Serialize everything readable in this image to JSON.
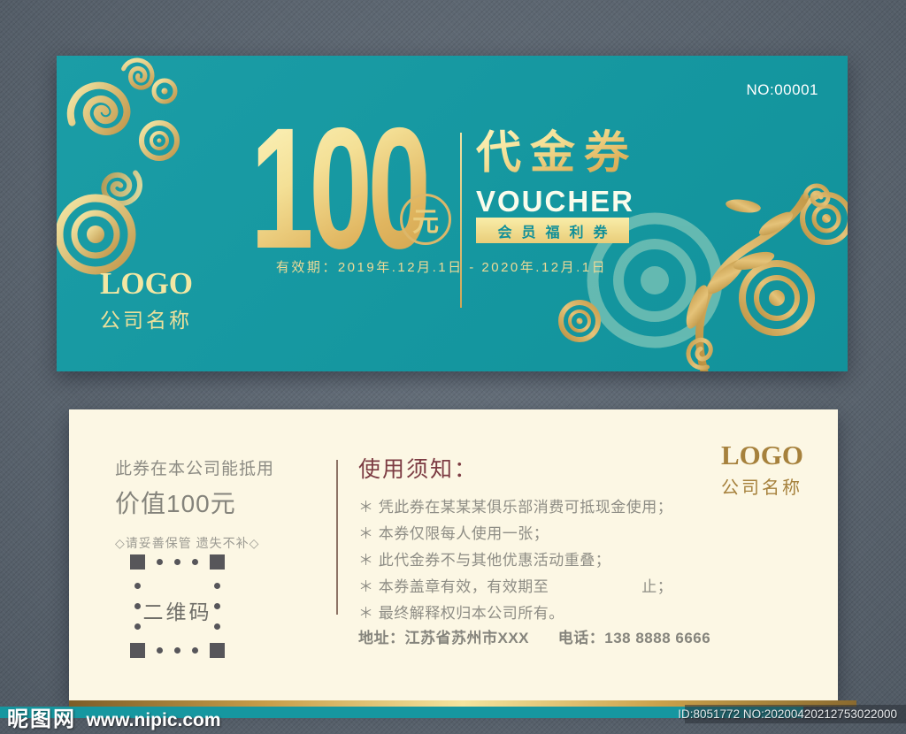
{
  "voucher": {
    "serial": "NO:00001",
    "amount": "100",
    "currency": "元",
    "title_cn": "代金券",
    "title_en": "VOUCHER",
    "badge": "会员福利券",
    "validity": "有效期：2019年.12月.1日 - 2020年.12月.1日",
    "logo": "LOGO",
    "company": "公司名称"
  },
  "stub": {
    "value_line1": "此券在本公司能抵用",
    "value_line2": "价值100元",
    "keep_note": "◇请妥善保管 遗失不补◇",
    "qr_label": "二维码",
    "notice_title": "使用须知：",
    "notes": [
      "＊ 凭此券在某某某俱乐部消费可抵现金使用；",
      "＊ 本券仅限每人使用一张；",
      "＊ 此代金券不与其他优惠活动重叠；",
      "＊ 本券盖章有效，有效期至　　　　　　止；",
      "＊ 最终解释权归本公司所有。"
    ],
    "address": "地址：江苏省苏州市XXX",
    "phone": "电话：138 8888 6666",
    "logo": "LOGO",
    "company": "公司名称"
  },
  "watermark": {
    "site_name": "昵图网",
    "site_url": "www.nipic.com",
    "id_text": "ID:8051772 NO:20200420212753022000"
  },
  "colors": {
    "teal": "#1597a0",
    "gold": "#e0b55f",
    "cream": "#fcf7e4",
    "notice_red": "#7c3b42"
  }
}
